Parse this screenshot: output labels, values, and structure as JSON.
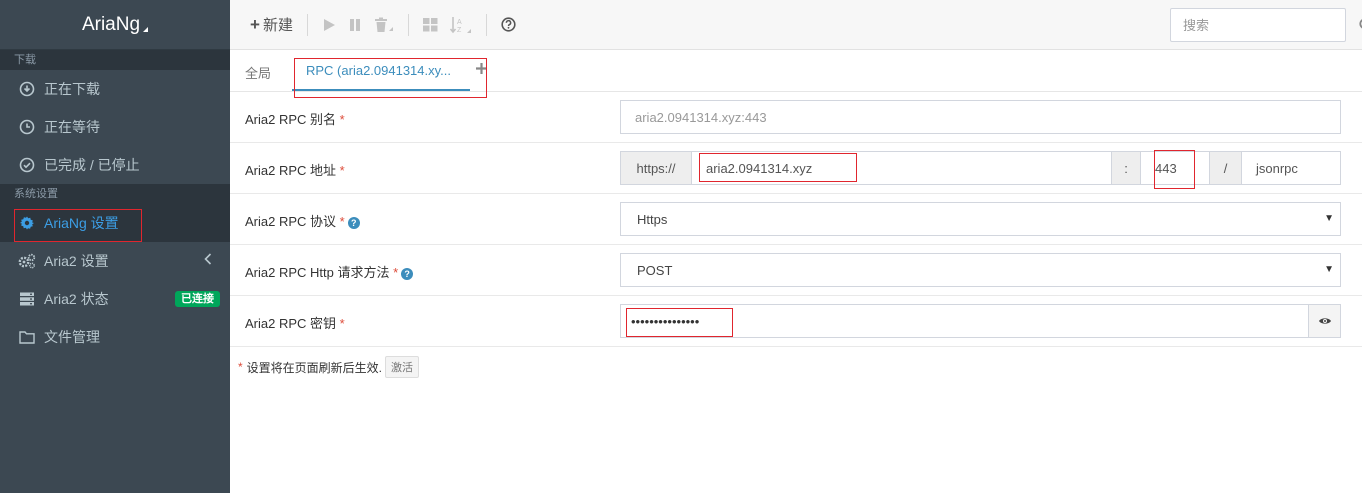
{
  "sidebar": {
    "brand": "AriaNg",
    "sections": [
      "下载",
      "系统设置"
    ],
    "items": [
      {
        "label": "正在下载",
        "icon": "download-icon"
      },
      {
        "label": "正在等待",
        "icon": "clock-icon"
      },
      {
        "label": "已完成 / 已停止",
        "icon": "check-circle-icon"
      },
      {
        "label": "AriaNg 设置",
        "icon": "gear-icon"
      },
      {
        "label": "Aria2 设置",
        "icon": "gears-icon"
      },
      {
        "label": "Aria2 状态",
        "icon": "server-icon",
        "badge": "已连接"
      },
      {
        "label": "文件管理",
        "icon": "folder-icon"
      }
    ]
  },
  "toolbar": {
    "new_label": "新建",
    "search_placeholder": "搜索"
  },
  "tabs": {
    "global": "全局",
    "rpc": "RPC (aria2.0941314.xy..."
  },
  "form": {
    "alias_label": "Aria2 RPC 别名",
    "alias_value": "aria2.0941314.xyz:443",
    "address_label": "Aria2 RPC 地址",
    "address_scheme": "https://",
    "address_host": "aria2.0941314.xyz",
    "address_colon": ":",
    "address_port": "443",
    "address_slash": "/",
    "address_path": "jsonrpc",
    "protocol_label": "Aria2 RPC 协议",
    "protocol_value": "Https",
    "method_label": "Aria2 RPC Http 请求方法",
    "method_value": "POST",
    "secret_label": "Aria2 RPC 密钥",
    "secret_value": "•••••••••••••••",
    "required_mark": "*"
  },
  "note": {
    "text": "设置将在页面刷新后生效.",
    "button": "激活"
  },
  "colors": {
    "sidebar_bg": "#3c4852",
    "accent": "#3c8dbc",
    "badge_green": "#00a65a",
    "highlight_red": "#e0262e"
  }
}
